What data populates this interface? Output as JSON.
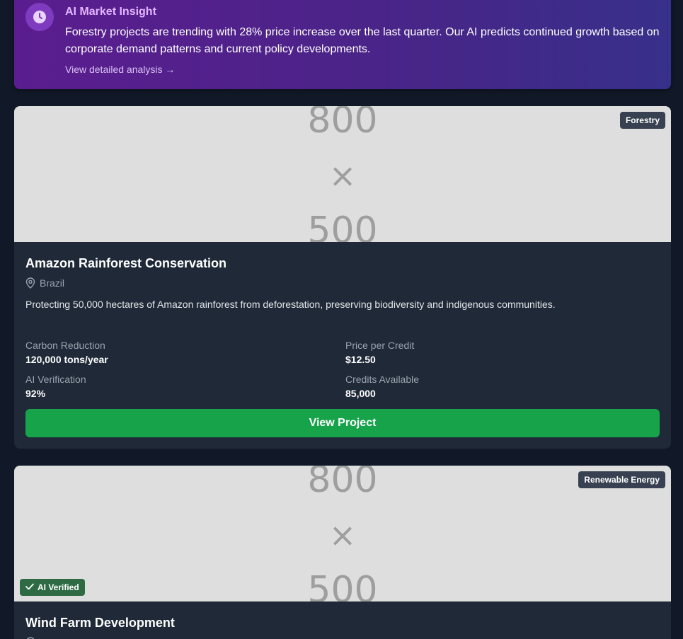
{
  "insight": {
    "title": "AI Market Insight",
    "body": "Forestry projects are trending with 28% price increase over the last quarter. Our AI predicts continued growth based on corporate demand patterns and current policy developments.",
    "link_label": "View detailed analysis →",
    "icon": "clock-icon"
  },
  "projects": [
    {
      "image_placeholder": {
        "top": "800",
        "mid": "×",
        "bottom": "500"
      },
      "category": "Forestry",
      "title": "Amazon Rainforest Conservation",
      "location": "Brazil",
      "description": "Protecting 50,000 hectares of Amazon rainforest from deforestation, preserving biodiversity and indigenous communities.",
      "stats": {
        "carbon_reduction_label": "Carbon Reduction",
        "carbon_reduction_value": "120,000 tons/year",
        "price_label": "Price per Credit",
        "price_value": "$12.50",
        "ai_verification_label": "AI Verification",
        "ai_verification_value": "92%",
        "credits_label": "Credits Available",
        "credits_value": "85,000"
      },
      "button_label": "View Project"
    },
    {
      "image_placeholder": {
        "top": "800",
        "mid": "×",
        "bottom": "500"
      },
      "category": "Renewable Energy",
      "verified_label": "AI Verified",
      "title": "Wind Farm Development"
    }
  ],
  "colors": {
    "background": "#111827",
    "card": "#1f2937",
    "accent_green": "#16a34a",
    "insight_purple": "#5b1d8f"
  }
}
